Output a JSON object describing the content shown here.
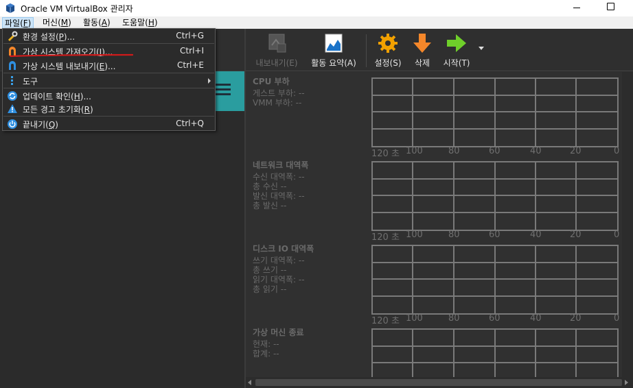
{
  "window": {
    "title": "Oracle VM VirtualBox 관리자"
  },
  "menubar": {
    "items": [
      {
        "label": "파일(",
        "key": "F",
        "tail": ")"
      },
      {
        "label": "머신(",
        "key": "M",
        "tail": ")"
      },
      {
        "label": "활동(",
        "key": "A",
        "tail": ")"
      },
      {
        "label": "도움말(",
        "key": "H",
        "tail": ")"
      }
    ]
  },
  "file_menu": {
    "items": [
      {
        "label": "환경 설정(",
        "key": "P",
        "tail": ")...",
        "shortcut": "Ctrl+G",
        "icon": "wrench-icon"
      },
      {
        "label": "가상 시스템 가져오기(",
        "key": "I",
        "tail": ")...",
        "shortcut": "Ctrl+I",
        "icon": "import-appliance-icon"
      },
      {
        "label": "가상 시스템 내보내기(",
        "key": "E",
        "tail": ")...",
        "shortcut": "Ctrl+E",
        "icon": "export-appliance-icon"
      },
      {
        "label": "도구",
        "key": "",
        "tail": "",
        "shortcut": "",
        "icon": "tools-icon"
      },
      {
        "label": "업데이트 확인(",
        "key": "H",
        "tail": ")...",
        "shortcut": "",
        "icon": "update-icon"
      },
      {
        "label": "모든 경고 초기화(",
        "key": "R",
        "tail": ")",
        "shortcut": "",
        "icon": "warning-icon"
      },
      {
        "label": "끝내기(",
        "key": "Q",
        "tail": ")",
        "shortcut": "Ctrl+Q",
        "icon": "power-icon"
      }
    ]
  },
  "toolbar": {
    "export_label": "내보내기(E)",
    "activity_label": "활동 요약(A)",
    "settings_label": "설정(S)",
    "delete_label": "삭제",
    "start_label": "시작(T)"
  },
  "monitor": {
    "cpu": {
      "title": "CPU 부하",
      "rows": [
        "게스트 부하: --",
        "VMM 부하: --"
      ]
    },
    "network": {
      "title": "네트워크 대역폭",
      "rows": [
        "수신 대역폭: --",
        "총 수신 --",
        "발신 대역폭: --",
        "총 발신 --"
      ]
    },
    "disk": {
      "title": "디스크 IO 대역폭",
      "rows": [
        "쓰기 대역폭: --",
        "총 쓰기 --",
        "읽기 대역폭: --",
        "총 읽기 --"
      ]
    },
    "vmexit": {
      "title": "가상 머신 종료",
      "rows": [
        "현재: --",
        "합계: --"
      ]
    },
    "ticks": [
      "120 초",
      "100",
      "80",
      "60",
      "40",
      "20",
      "0"
    ]
  },
  "colors": {
    "accent_teal": "#2a9d9f",
    "annotation_red": "#d11a1a",
    "menu_highlight": "#cce4f7"
  }
}
